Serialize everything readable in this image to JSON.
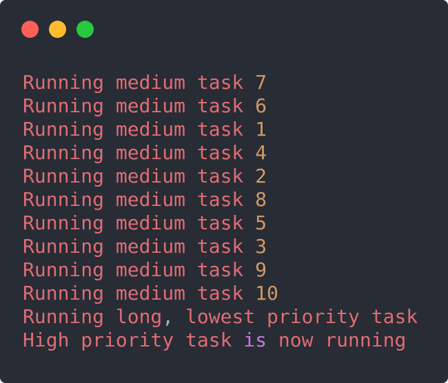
{
  "window": {
    "background": "#282c34",
    "controls": [
      {
        "name": "close",
        "color": "#ff5f56"
      },
      {
        "name": "minimize",
        "color": "#ffbd2e"
      },
      {
        "name": "maximize",
        "color": "#27c93f"
      }
    ]
  },
  "terminal": {
    "colors": {
      "text": "#e06c75",
      "number": "#d19a66",
      "punctuation": "#abb2bf",
      "keyword": "#c678dd"
    },
    "lines": [
      {
        "text": "Running medium task ",
        "num": "7"
      },
      {
        "text": "Running medium task ",
        "num": "6"
      },
      {
        "text": "Running medium task ",
        "num": "1"
      },
      {
        "text": "Running medium task ",
        "num": "4"
      },
      {
        "text": "Running medium task ",
        "num": "2"
      },
      {
        "text": "Running medium task ",
        "num": "8"
      },
      {
        "text": "Running medium task ",
        "num": "5"
      },
      {
        "text": "Running medium task ",
        "num": "3"
      },
      {
        "text": "Running medium task ",
        "num": "9"
      },
      {
        "text": "Running medium task ",
        "num": "10"
      }
    ],
    "long_line": {
      "part1": "Running long",
      "comma": ",",
      "part2": " lowest priority task"
    },
    "high_line": {
      "part1": "High priority task ",
      "keyword": "is",
      "part2": " now running"
    }
  }
}
